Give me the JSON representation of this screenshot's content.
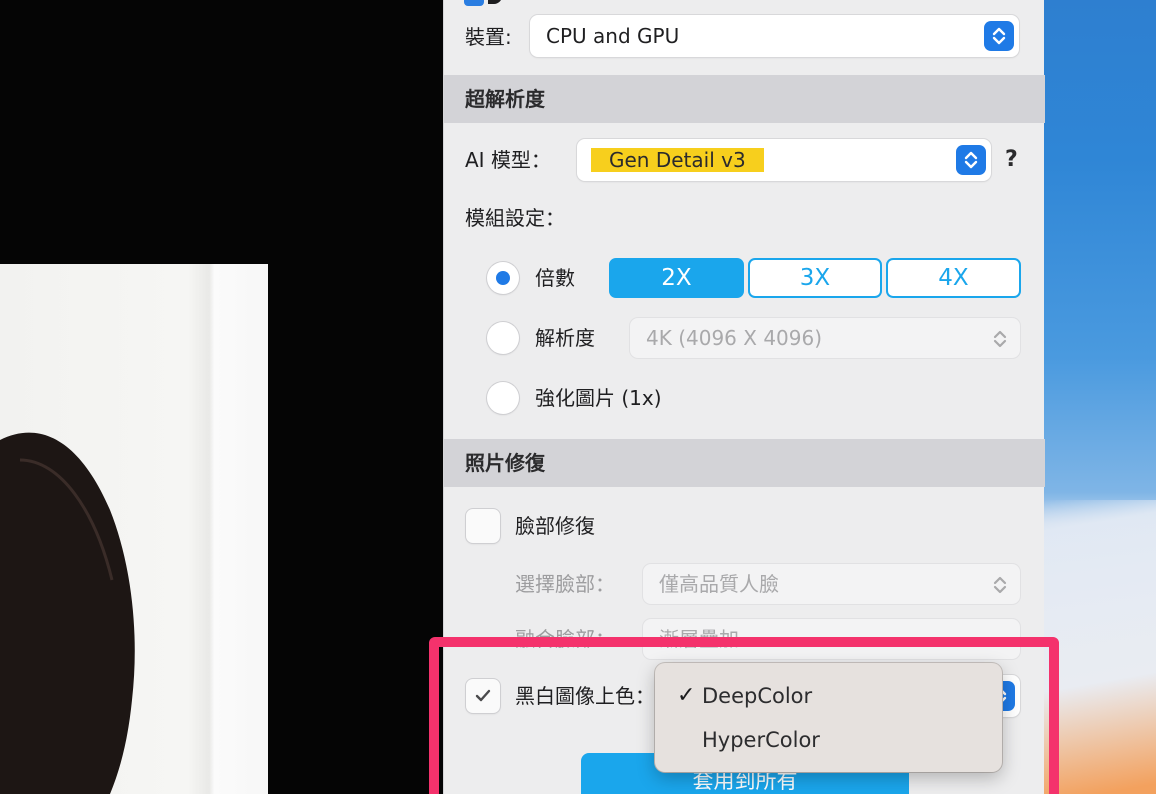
{
  "device": {
    "label": "裝置:",
    "value": "CPU and GPU"
  },
  "super_resolution": {
    "section_title": "超解析度",
    "ai_model_label": "AI 模型：",
    "ai_model_value": "Gen Detail v3",
    "help": "?",
    "module_settings_label": "模組設定：",
    "scale_option_label": "倍數",
    "scale_buttons": [
      "2X",
      "3X",
      "4X"
    ],
    "resolution_option_label": "解析度",
    "resolution_value": "4K (4096 X 4096)",
    "enhance_option_label": "強化圖片 (1x)"
  },
  "photo_repair": {
    "section_title": "照片修復",
    "face_repair_label": "臉部修復",
    "select_face_label": "選擇臉部：",
    "select_face_value": "僅高品質人臉",
    "blend_face_label": "融合臉部：",
    "blend_face_value": "漸層疊加",
    "colorize_label": "黑白圖像上色："
  },
  "dropdown": {
    "items": [
      "DeepColor",
      "HyperColor"
    ],
    "selected": "DeepColor",
    "checkmark": "✓"
  },
  "apply_all_label": "套用到所有",
  "colors": {
    "accent": "#1aa6ec",
    "highlight_frame": "#f4326c",
    "highlight_text": "#f7cf1d"
  }
}
